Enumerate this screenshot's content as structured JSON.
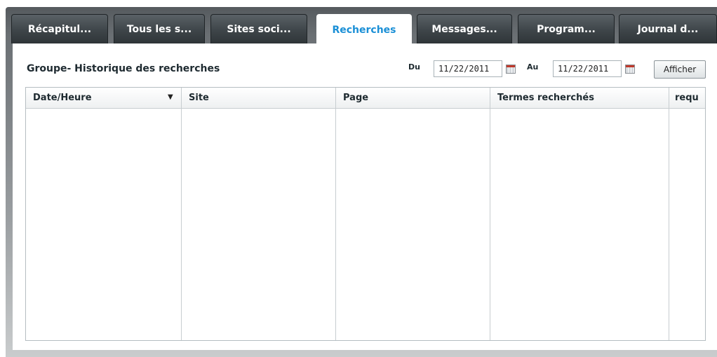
{
  "tabs": [
    {
      "label": "Récapitul..."
    },
    {
      "label": "Tous les s..."
    },
    {
      "label": "Sites soci..."
    },
    {
      "label": "Recherches"
    },
    {
      "label": "Messages..."
    },
    {
      "label": "Program..."
    },
    {
      "label": "Journal d..."
    }
  ],
  "panel": {
    "title": "Groupe- Historique des recherches",
    "from_label": "Du",
    "from_date": "11/22/2011",
    "to_label": "Au",
    "to_date": "11/22/2011",
    "show_button": "Afficher"
  },
  "grid": {
    "columns": [
      "Date/Heure",
      "Site",
      "Page",
      "Termes recherchés",
      "requ"
    ],
    "sort_indicator": "▼"
  },
  "colors": {
    "active_tab_text": "#1a8fd6",
    "tab_bg": "#3e4549"
  }
}
